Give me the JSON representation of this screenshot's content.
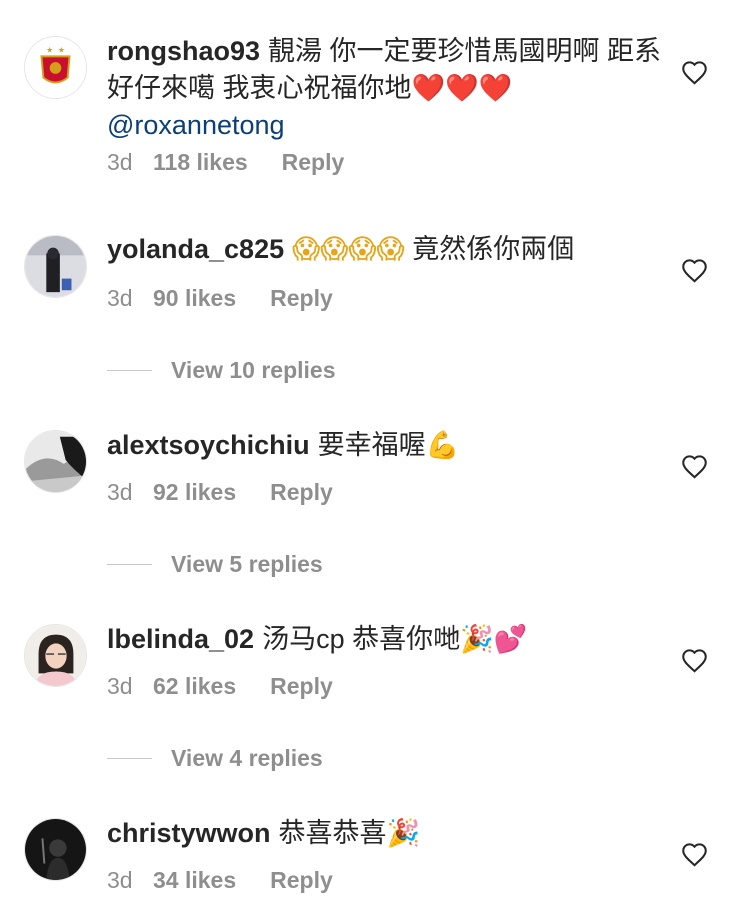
{
  "comments": [
    {
      "username": "rongshao93",
      "text": "靚湯 你一定要珍惜馬國明啊 距系好仔來噶 我衷心祝福你地",
      "emoji": "❤️❤️❤️",
      "mention": "@roxannetong",
      "time": "3d",
      "likes": "118 likes",
      "reply": "Reply",
      "avatar": "club-crest-avatar"
    },
    {
      "username": "yolanda_c825",
      "text": "竟然係你兩個",
      "emoji_before": "😱😱😱😱",
      "time": "3d",
      "likes": "90 likes",
      "reply": "Reply",
      "view_replies": "View 10 replies",
      "avatar": "photo-avatar"
    },
    {
      "username": "alextsoychichiu",
      "text": "要幸福喔",
      "emoji": "💪",
      "time": "3d",
      "likes": "92 likes",
      "reply": "Reply",
      "view_replies": "View 5 replies",
      "avatar": "photo-avatar"
    },
    {
      "username": "lbelinda_02",
      "text": "汤马cp 恭喜你哋",
      "emoji": "🎉💕",
      "time": "3d",
      "likes": "62 likes",
      "reply": "Reply",
      "view_replies": "View 4 replies",
      "avatar": "photo-avatar"
    },
    {
      "username": "christywwon",
      "text": "恭喜恭喜",
      "emoji": "🎉",
      "time": "3d",
      "likes": "34 likes",
      "reply": "Reply",
      "avatar": "photo-avatar"
    }
  ],
  "colors": {
    "text": "#262626",
    "meta": "#8e8e8e",
    "mention": "#0b3f7a",
    "divider": "#c7c7c7"
  }
}
